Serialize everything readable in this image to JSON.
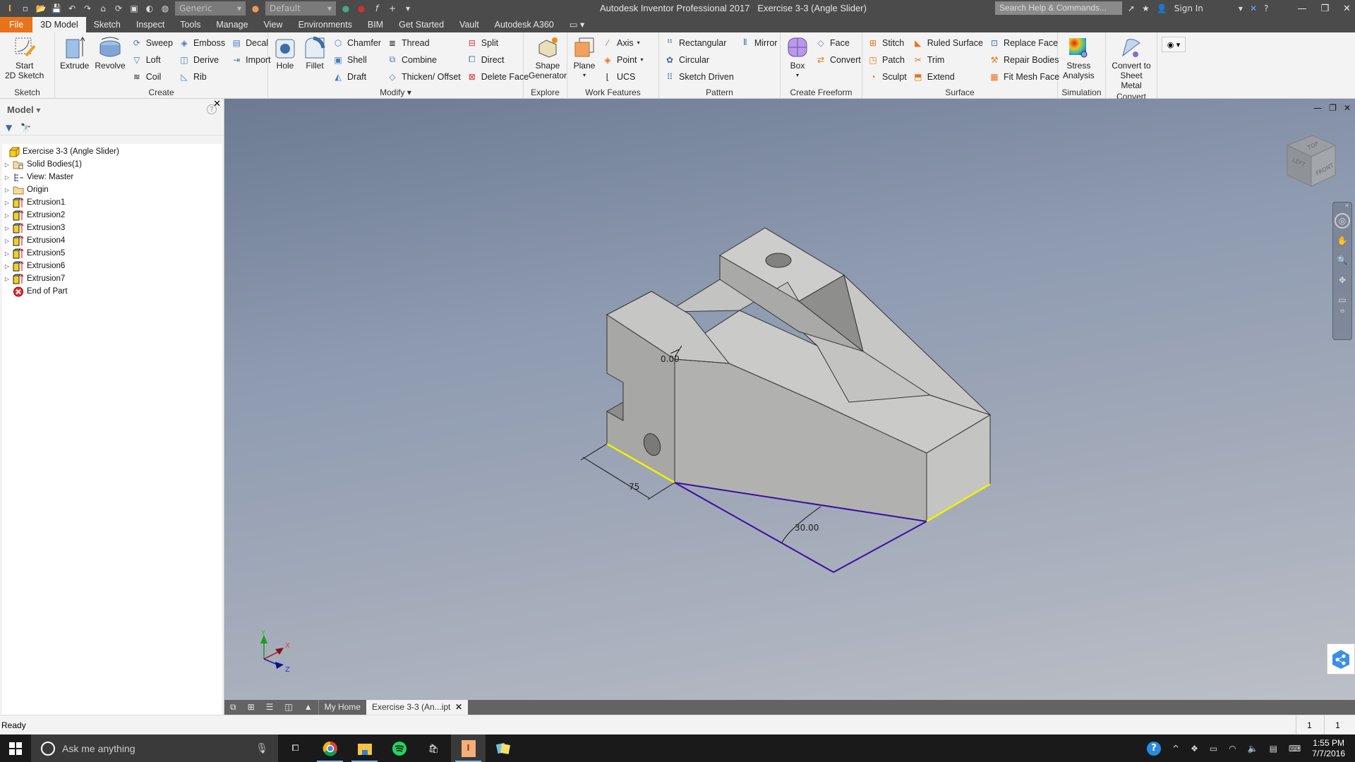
{
  "titlebar": {
    "app_title": "Autodesk Inventor Professional 2017",
    "doc_title": "Exercise 3-3 (Angle Slider)",
    "material_select": "Generic",
    "appearance_select": "Default",
    "search_placeholder": "Search Help & Commands...",
    "sign_in": "Sign In",
    "help": "?"
  },
  "tabs": [
    "File",
    "3D Model",
    "Sketch",
    "Inspect",
    "Tools",
    "Manage",
    "View",
    "Environments",
    "BIM",
    "Get Started",
    "Vault",
    "Autodesk A360"
  ],
  "active_tab": "3D Model",
  "ribbon": {
    "sketch": {
      "title": "Sketch",
      "start_line1": "Start",
      "start_line2": "2D Sketch"
    },
    "create": {
      "title": "Create",
      "extrude": "Extrude",
      "revolve": "Revolve",
      "sweep": "Sweep",
      "loft": "Loft",
      "coil": "Coil",
      "emboss": "Emboss",
      "derive": "Derive",
      "rib": "Rib",
      "decal": "Decal",
      "import": "Import"
    },
    "modify": {
      "title": "Modify",
      "hole": "Hole",
      "fillet": "Fillet",
      "chamfer": "Chamfer",
      "shell": "Shell",
      "draft": "Draft",
      "thread": "Thread",
      "combine": "Combine",
      "thicken": "Thicken/ Offset",
      "split": "Split",
      "direct": "Direct",
      "delete_face": "Delete Face"
    },
    "explore": {
      "title": "Explore",
      "shape_line1": "Shape",
      "shape_line2": "Generator"
    },
    "work_features": {
      "title": "Work Features",
      "plane": "Plane",
      "axis": "Axis",
      "point": "Point",
      "ucs": "UCS"
    },
    "pattern": {
      "title": "Pattern",
      "rectangular": "Rectangular",
      "circular": "Circular",
      "sketch_driven": "Sketch Driven",
      "mirror": "Mirror"
    },
    "freeform": {
      "title": "Create Freeform",
      "box": "Box",
      "face": "Face",
      "convert": "Convert"
    },
    "surface": {
      "title": "Surface",
      "stitch": "Stitch",
      "patch": "Patch",
      "sculpt": "Sculpt",
      "ruled_surface": "Ruled Surface",
      "trim": "Trim",
      "extend": "Extend",
      "replace_face": "Replace Face",
      "repair_bodies": "Repair Bodies",
      "fit_mesh_face": "Fit Mesh Face"
    },
    "simulation": {
      "title": "Simulation",
      "line1": "Stress",
      "line2": "Analysis"
    },
    "convert": {
      "title": "Convert",
      "line1": "Convert to",
      "line2": "Sheet Metal"
    }
  },
  "browser": {
    "title": "Model",
    "tree": [
      {
        "label": "Exercise 3-3 (Angle Slider)",
        "icon": "part-icon",
        "expandable": false
      },
      {
        "label": "Solid Bodies(1)",
        "icon": "solid-bodies-icon",
        "expandable": true
      },
      {
        "label": "View: Master",
        "icon": "view-icon",
        "expandable": true
      },
      {
        "label": "Origin",
        "icon": "folder-icon",
        "expandable": true
      },
      {
        "label": "Extrusion1",
        "icon": "extrusion-icon",
        "expandable": true
      },
      {
        "label": "Extrusion2",
        "icon": "extrusion-icon",
        "expandable": true
      },
      {
        "label": "Extrusion3",
        "icon": "extrusion-icon",
        "expandable": true
      },
      {
        "label": "Extrusion4",
        "icon": "extrusion-icon",
        "expandable": true
      },
      {
        "label": "Extrusion5",
        "icon": "extrusion-icon",
        "expandable": true
      },
      {
        "label": "Extrusion6",
        "icon": "extrusion-icon",
        "expandable": true
      },
      {
        "label": "Extrusion7",
        "icon": "extrusion-icon",
        "expandable": true
      },
      {
        "label": "End of Part",
        "icon": "end-of-part-icon",
        "expandable": false
      }
    ]
  },
  "viewport": {
    "dimensions": {
      "angle_top": "0.00",
      "length": "75",
      "angle": "30.00"
    },
    "viewcube": {
      "top": "TOP",
      "left": "LEFT",
      "front": "FRONT"
    },
    "triad": {
      "x": "X",
      "y": "Y",
      "z": "Z"
    },
    "colors": {
      "sketch_line": "#3a0ea0",
      "highlight_edge": "#f2f200",
      "part_face": "#b4b4b2"
    }
  },
  "doc_tabs": {
    "home": "My Home",
    "active": "Exercise 3-3 (An...ipt"
  },
  "status": {
    "text": "Ready",
    "count1": "1",
    "count2": "1"
  },
  "taskbar": {
    "cortana": "Ask me anything",
    "time": "1:55 PM",
    "date": "7/7/2016"
  }
}
